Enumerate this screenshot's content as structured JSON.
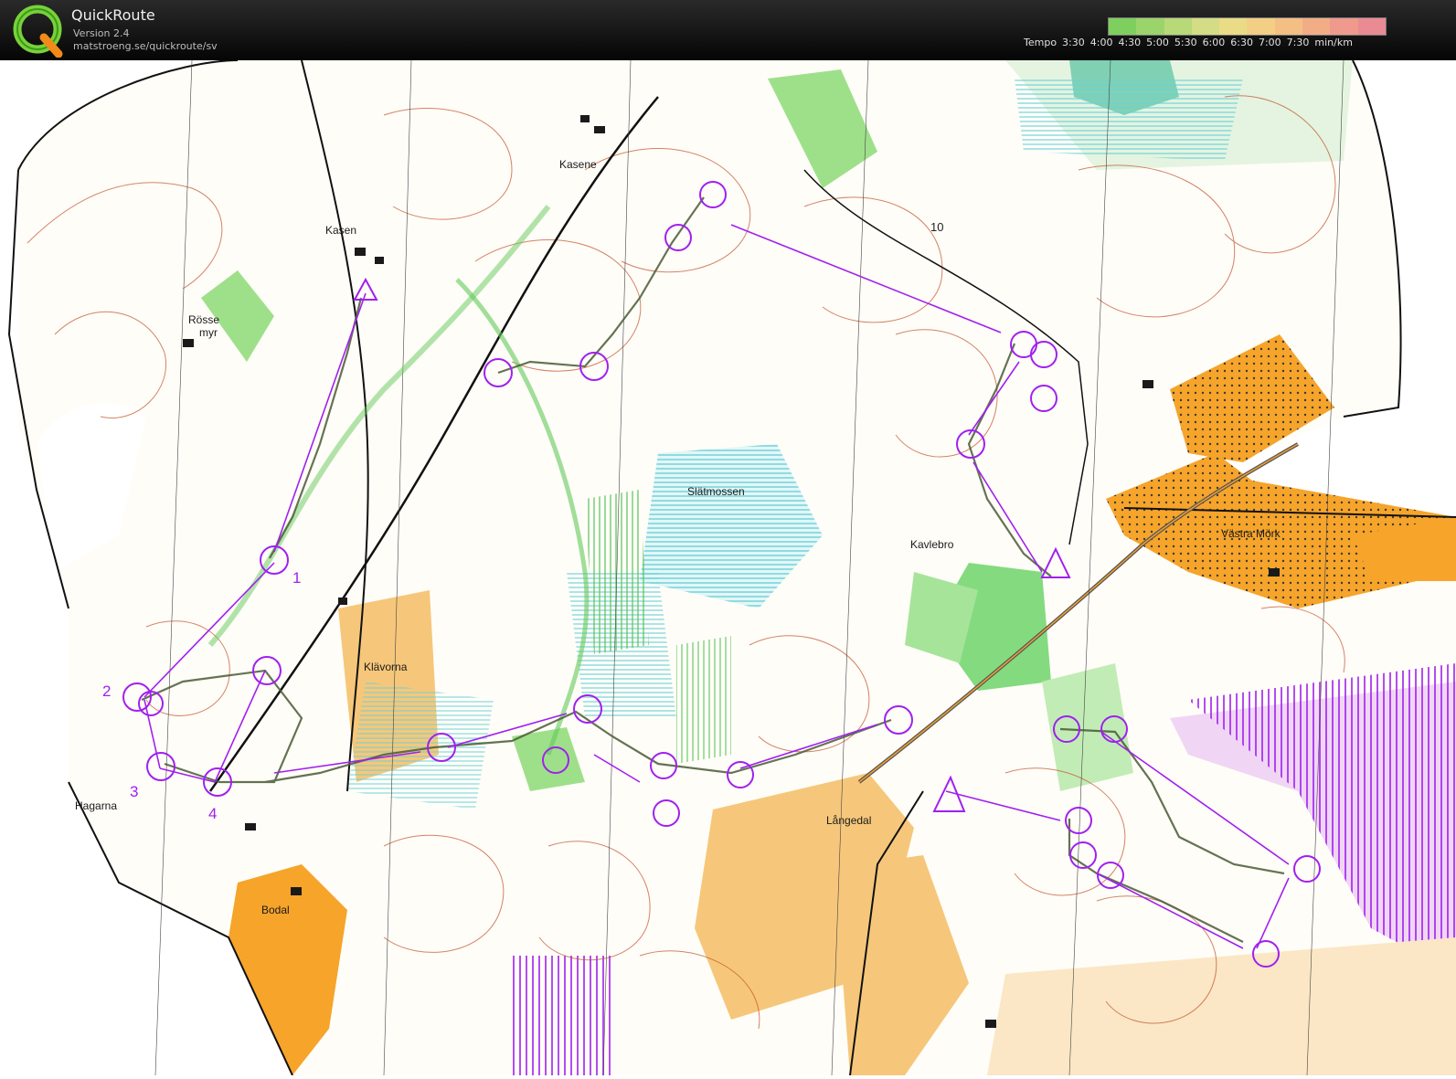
{
  "app": {
    "name": "QuickRoute",
    "version": "Version 2.4",
    "url": "matstroeng.se/quickroute/sv"
  },
  "pace_legend": {
    "label": "Tempo",
    "ticks": [
      "3:30",
      "4:00",
      "4:30",
      "5:00",
      "5:30",
      "6:00",
      "6:30",
      "7:00",
      "7:30"
    ],
    "unit": "min/km",
    "colors": [
      "#7fcf5f",
      "#9bd46a",
      "#b8d978",
      "#d4dd85",
      "#eadb86",
      "#f2cf84",
      "#f4bf84",
      "#f3ad86",
      "#ef9a8c",
      "#ea8a92"
    ]
  },
  "map": {
    "place_names": [
      {
        "text": "Kasene"
      },
      {
        "text": "Kasen"
      },
      {
        "text": "Rösse"
      },
      {
        "text": "myr"
      },
      {
        "text": "Slätmossen"
      },
      {
        "text": "Kavlebro"
      },
      {
        "text": "Västra Mörk"
      },
      {
        "text": "Klävorna"
      },
      {
        "text": "Hagarna"
      },
      {
        "text": "Långedal"
      },
      {
        "text": "Bodal"
      }
    ],
    "control_numbers": [
      "1",
      "2",
      "3",
      "4",
      "10"
    ],
    "colors": {
      "course": "#a020f0",
      "route": "#4a5a36",
      "forest_green": "#6fd36a",
      "open_yellow": "#f6b44a",
      "contour": "#c0502a",
      "marsh": "#6ad1d8"
    }
  }
}
